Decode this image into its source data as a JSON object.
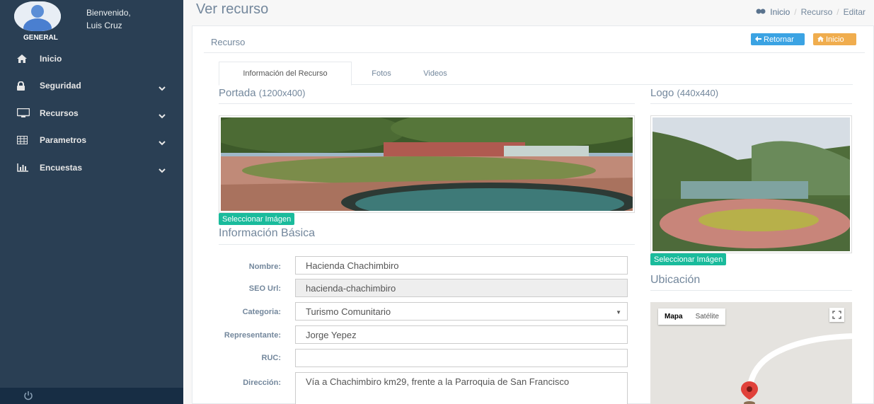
{
  "user": {
    "welcome": "Bienvenido,",
    "name": "Luis Cruz"
  },
  "sidebar": {
    "section": "GENERAL",
    "items": [
      {
        "label": "Inicio",
        "icon": "home-icon"
      },
      {
        "label": "Seguridad",
        "icon": "lock-icon"
      },
      {
        "label": "Recursos",
        "icon": "desktop-icon"
      },
      {
        "label": "Parametros",
        "icon": "table-icon"
      },
      {
        "label": "Encuestas",
        "icon": "bar-chart-icon"
      }
    ]
  },
  "header": {
    "title": "Ver recurso",
    "breadcrumb": [
      "Inicio",
      "Recurso",
      "Editar"
    ]
  },
  "panel": {
    "title": "Recurso",
    "btn_back": "Retornar",
    "btn_home": "Inicio"
  },
  "tabs": [
    "Información del Recurso",
    "Fotos",
    "Videos"
  ],
  "portada": {
    "title": "Portada",
    "size": "(1200x400)",
    "select": "Seleccionar Imágen"
  },
  "logo": {
    "title": "Logo",
    "size": "(440x440)",
    "select": "Seleccionar Imágen"
  },
  "basic": {
    "title": "Información Básica",
    "fields": [
      {
        "label": "Nombre:",
        "value": "Hacienda Chachimbiro"
      },
      {
        "label": "SEO Url:",
        "value": "hacienda-chachimbiro"
      },
      {
        "label": "Categoria:",
        "value": "Turismo Comunitario"
      },
      {
        "label": "Representante:",
        "value": "Jorge Yepez"
      },
      {
        "label": "RUC:",
        "value": ""
      },
      {
        "label": "Dirección:",
        "value": "Vía a Chachimbiro km29, frente a la Parroquia de San Francisco"
      }
    ]
  },
  "ubicacion": {
    "title": "Ubicación",
    "map_btn": "Mapa",
    "sat_btn": "Satélite"
  },
  "colors": {
    "sidebar": "#2a3f54",
    "accent": "#1abb9c",
    "blue": "#3ba3e3",
    "orange": "#f0ad4e"
  }
}
